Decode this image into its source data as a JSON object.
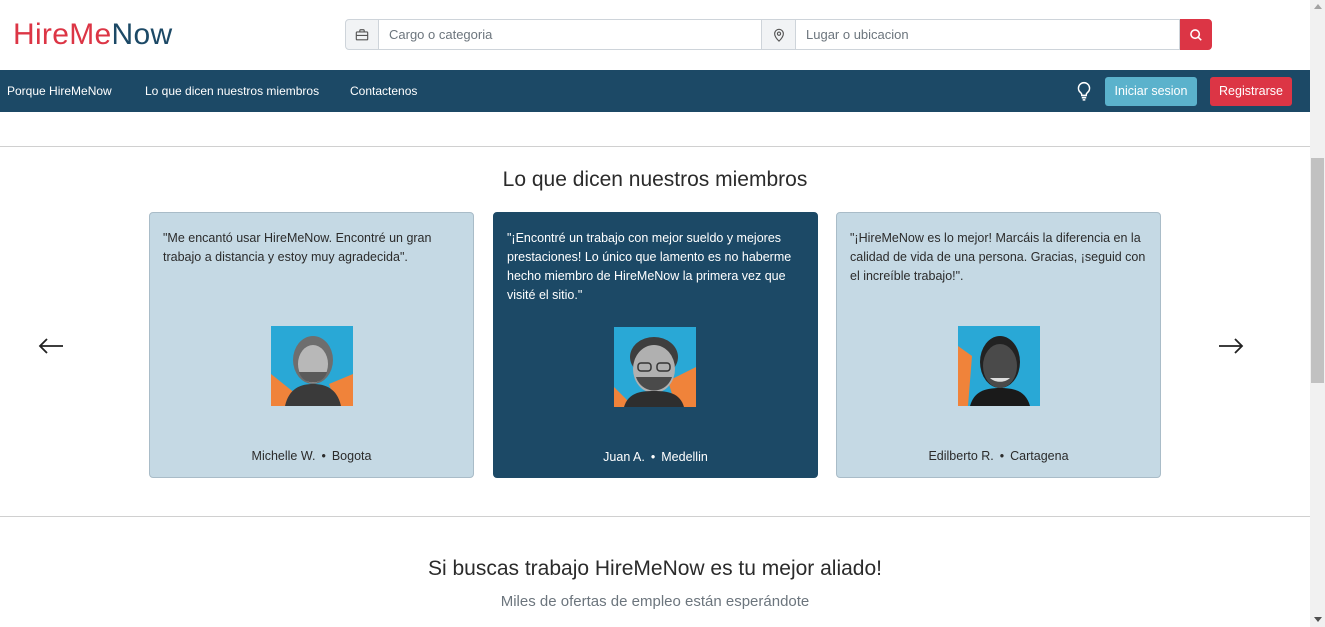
{
  "brand": {
    "part1": "Hire",
    "part2": "Me",
    "part3": "Now"
  },
  "search": {
    "job_placeholder": "Cargo o categoria",
    "location_placeholder": "Lugar o ubicacion"
  },
  "nav": {
    "items": [
      {
        "label": "Porque HireMeNow"
      },
      {
        "label": "Lo que dicen nuestros miembros"
      },
      {
        "label": "Contactenos"
      }
    ],
    "login_label": "Iniciar sesion",
    "register_label": "Registrarse"
  },
  "testimonials": {
    "title": "Lo que dicen nuestros miembros",
    "cards": [
      {
        "quote": "\"Me encantó usar HireMeNow. Encontré un gran trabajo a distancia y estoy muy agradecida\".",
        "name": "Michelle W.",
        "city": "Bogota"
      },
      {
        "quote": "\"¡Encontré un trabajo con mejor sueldo y mejores prestaciones! Lo único que lamento es no haberme hecho miembro de HireMeNow la primera vez que visité el sitio.\"",
        "name": "Juan A.",
        "city": "Medellin"
      },
      {
        "quote": "\"¡HireMeNow es lo mejor! Marcáis la diferencia en la calidad de vida de una persona. Gracias, ¡seguid con el increíble trabajo!\".",
        "name": "Edilberto R.",
        "city": "Cartagena"
      }
    ],
    "separator": "•"
  },
  "cta": {
    "title": "Si buscas trabajo HireMeNow es tu mejor aliado!",
    "subtitle": "Miles de ofertas de empleo están esperándote"
  },
  "colors": {
    "primary": "#1c4966",
    "accent": "#dc3545",
    "info": "#5bb2cc",
    "card_light": "#c5d9e4"
  }
}
